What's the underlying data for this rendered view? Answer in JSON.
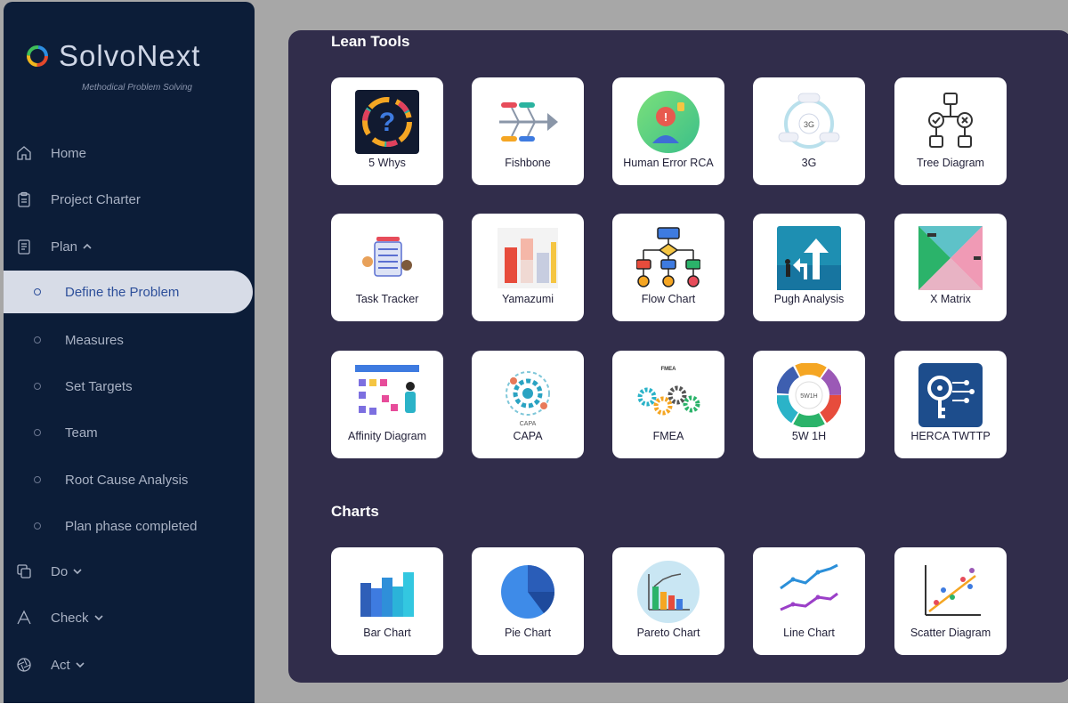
{
  "app": {
    "name": "SolvoNext",
    "tagline": "Methodical Problem Solving"
  },
  "sidebar": {
    "items": [
      {
        "label": "Home",
        "icon": "home-icon"
      },
      {
        "label": "Project Charter",
        "icon": "clipboard-icon"
      },
      {
        "label": "Plan",
        "icon": "document-icon",
        "expanded": true
      },
      {
        "label": "Do",
        "icon": "copy-icon",
        "expanded": false
      },
      {
        "label": "Check",
        "icon": "check-a-icon",
        "expanded": false
      },
      {
        "label": "Act",
        "icon": "aperture-icon",
        "expanded": false
      }
    ],
    "plan_subitems": [
      {
        "label": "Define the Problem",
        "active": true
      },
      {
        "label": "Measures"
      },
      {
        "label": "Set Targets"
      },
      {
        "label": "Team"
      },
      {
        "label": "Root Cause Analysis"
      },
      {
        "label": "Plan phase completed"
      }
    ]
  },
  "main": {
    "lean_title": "Lean Tools",
    "charts_title": "Charts",
    "lean_tools": [
      {
        "label": "5 Whys",
        "icon": "question-cycle-icon"
      },
      {
        "label": "Fishbone",
        "icon": "fishbone-icon"
      },
      {
        "label": "Human Error RCA",
        "icon": "human-error-icon"
      },
      {
        "label": "3G",
        "icon": "3g-cycle-icon"
      },
      {
        "label": "Tree Diagram",
        "icon": "tree-diagram-icon"
      },
      {
        "label": "Task Tracker",
        "icon": "task-tracker-icon"
      },
      {
        "label": "Yamazumi",
        "icon": "yamazumi-icon"
      },
      {
        "label": "Flow Chart",
        "icon": "flow-chart-icon"
      },
      {
        "label": "Pugh Analysis",
        "icon": "pugh-analysis-icon"
      },
      {
        "label": "X Matrix",
        "icon": "x-matrix-icon"
      },
      {
        "label": "Affinity Diagram",
        "icon": "affinity-diagram-icon"
      },
      {
        "label": "CAPA",
        "icon": "capa-gear-icon"
      },
      {
        "label": "FMEA",
        "icon": "fmea-gears-icon"
      },
      {
        "label": "5W 1H",
        "icon": "5w1h-wheel-icon"
      },
      {
        "label": "HERCA TWTTP",
        "icon": "herca-key-icon"
      }
    ],
    "charts": [
      {
        "label": "Bar Chart",
        "icon": "bar-chart-icon"
      },
      {
        "label": "Pie Chart",
        "icon": "pie-chart-icon"
      },
      {
        "label": "Pareto Chart",
        "icon": "pareto-chart-icon"
      },
      {
        "label": "Line Chart",
        "icon": "line-chart-icon"
      },
      {
        "label": "Scatter Diagram",
        "icon": "scatter-diagram-icon"
      }
    ],
    "tool_image_text": {
      "fmea": "FMEA",
      "capa": "CAPA",
      "threeg": "3G",
      "fivew": "5W1H"
    }
  },
  "colors": {
    "sidebar_bg": "#0c1d38",
    "panel_bg": "#312d4b",
    "active_bg": "#d7dce7",
    "active_text": "#2d4f9a"
  }
}
